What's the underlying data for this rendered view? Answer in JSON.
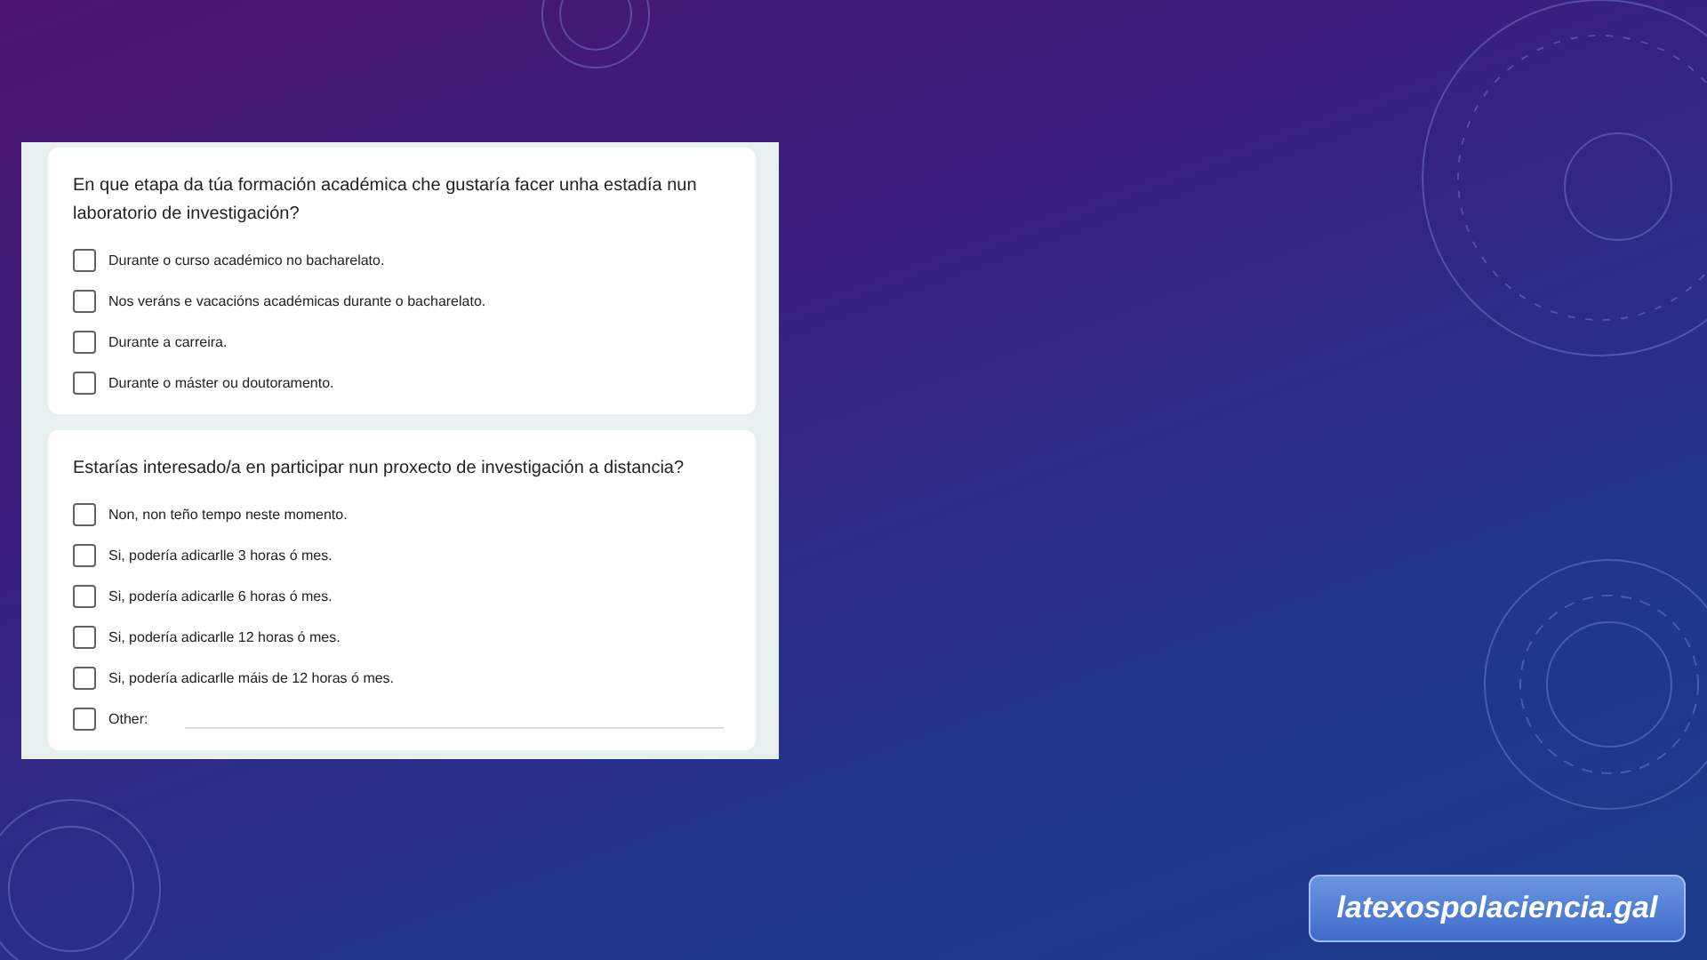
{
  "questions": [
    {
      "title": "En que etapa da túa formación académica che gustaría facer unha estadía nun laboratorio de investigación?",
      "options": [
        {
          "label": "Durante o curso académico no bacharelato.",
          "kind": "checkbox",
          "checked": false
        },
        {
          "label": "Nos veráns e vacacións académicas durante o bacharelato.",
          "kind": "checkbox",
          "checked": false
        },
        {
          "label": "Durante a carreira.",
          "kind": "checkbox",
          "checked": false
        },
        {
          "label": "Durante o máster ou doutoramento.",
          "kind": "checkbox",
          "checked": false
        }
      ]
    },
    {
      "title": "Estarías interesado/a en participar nun proxecto de investigación a distancia?",
      "options": [
        {
          "label": "Non, non teño tempo neste momento.",
          "kind": "checkbox",
          "checked": false
        },
        {
          "label": "Si, podería adicarlle 3 horas ó mes.",
          "kind": "checkbox",
          "checked": false
        },
        {
          "label": "Si, podería adicarlle 6 horas ó mes.",
          "kind": "checkbox",
          "checked": false
        },
        {
          "label": "Si, podería adicarlle 12 horas ó mes.",
          "kind": "checkbox",
          "checked": false
        },
        {
          "label": "Si, podería adicarlle máis de 12 horas ó mes.",
          "kind": "checkbox",
          "checked": false
        },
        {
          "label": "Other:",
          "kind": "other",
          "checked": false
        }
      ]
    }
  ],
  "site_badge": "latexospolaciencia.gal"
}
